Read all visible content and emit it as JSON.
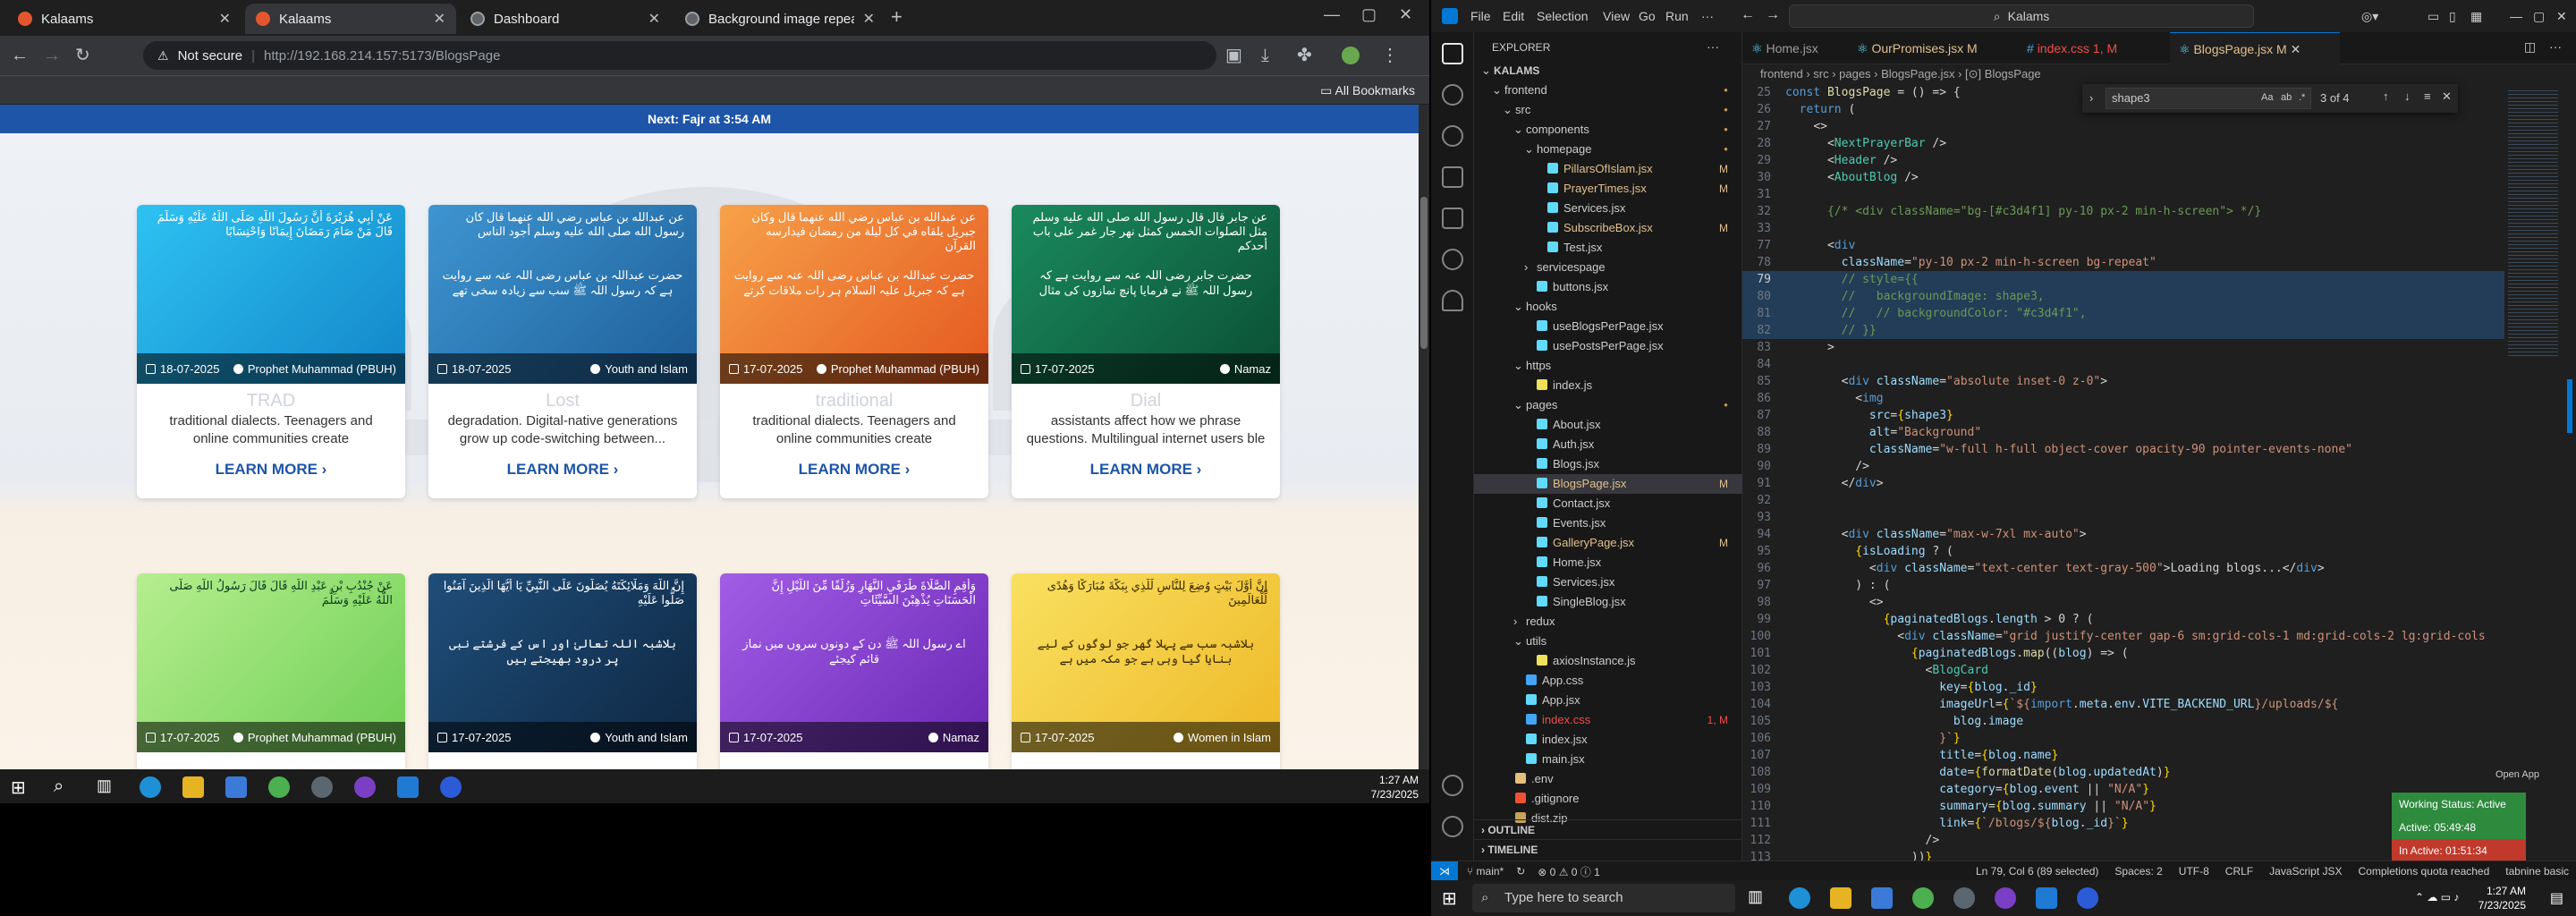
{
  "chrome": {
    "tabs": [
      {
        "label": "Kalaams",
        "active": false
      },
      {
        "label": "Kalaams",
        "active": true
      },
      {
        "label": "Dashboard",
        "active": false
      },
      {
        "label": "Background image repeat",
        "active": false
      }
    ],
    "security_label": "Not secure",
    "url": "http://192.168.214.157:5173/BlogsPage",
    "bookmarks_label": "All Bookmarks"
  },
  "site": {
    "prayer_bar": "Next: Fajr at 3:54 AM",
    "learn_more": "LEARN MORE ›",
    "cards_row1": [
      {
        "arabic": "عَنْ أَبِي هُرَيْرَةَ أَنَّ رَسُولَ اللَّهِ صَلَّى اللَّهُ عَلَيْهِ وَسَلَّمَ قَالَ مَنْ صَامَ رَمَضَانَ إِيمَانًا وَاحْتِسَابًا",
        "urdu": "",
        "date": "18-07-2025",
        "category": "Prophet Muhammad (PBUH)",
        "title": "TRAD",
        "summary": "traditional dialects. Teenagers and online communities create",
        "bg": "#1aa6e0"
      },
      {
        "arabic": "عن عبدالله بن عباس رضي الله عنهما قال كان رسول الله صلى الله عليه وسلم أجود الناس",
        "urdu": "حضرت عبداللہ بن عباس رضی اللہ عنہ سے روایت ہے کہ رسول اللہ ﷺ سب سے زیادہ سخی تھے",
        "date": "18-07-2025",
        "category": "Youth and Islam",
        "title": "Lost",
        "summary": "degradation. Digital-native generations grow up code-switching between...",
        "bg": "#2f7fbd"
      },
      {
        "arabic": "عن عبدالله بن عباس رضي الله عنهما قال وكان جبريل يلقاه في كل ليلة من رمضان فيدارسه القرآن",
        "urdu": "حضرت عبداللہ بن عباس رضی اللہ عنہ سے روایت ہے کہ جبریل علیہ السلام ہر رات ملاقات کرتے",
        "date": "17-07-2025",
        "category": "Prophet Muhammad (PBUH)",
        "title": "traditional",
        "summary": "traditional dialects. Teenagers and online communities create",
        "bg": "#f07a2a"
      },
      {
        "arabic": "عن جابر قال قال رسول الله صلى الله عليه وسلم مثل الصلوات الخمس كمثل نهر جار غمر على باب أحدكم",
        "urdu": "حضرت جابر رضی اللہ عنہ سے روایت ہے کہ رسول اللہ ﷺ نے فرمایا پانچ نمازوں کی مثال",
        "date": "17-07-2025",
        "category": "Namaz",
        "title": "Dial",
        "summary": "assistants affect how we phrase questions. Multilingual internet users ble",
        "bg": "#0f6e4a"
      }
    ],
    "cards_row2": [
      {
        "arabic": "عَنْ جُنْدُبِ بْنِ عَبْدِ اللَّهِ قَالَ قَالَ رَسُولُ اللَّهِ صَلَّى اللَّهُ عَلَيْهِ وَسَلَّمَ",
        "urdu": "",
        "date": "17-07-2025",
        "category": "Prophet Muhammad (PBUH)",
        "bg": "#9ee07a"
      },
      {
        "arabic": "إِنَّ اللَّهَ وَمَلَائِكَتَهُ يُصَلُّونَ عَلَى النَّبِيِّ يَا أَيُّهَا الَّذِينَ آمَنُوا صَلُّوا عَلَيْهِ",
        "urdu": "بلاشبہ اللہ تعالیٰ اور اس کے فرشتے نبی پر درود بھیجتے ہیں",
        "date": "17-07-2025",
        "category": "Youth and Islam",
        "bg": "#153a5e"
      },
      {
        "arabic": "وَأَقِمِ الصَّلَاةَ طَرَفَيِ النَّهَارِ وَزُلَفًا مِّنَ اللَّيْلِ إِنَّ الْحَسَنَاتِ يُذْهِبْنَ السَّيِّئَاتِ",
        "urdu": "اے رسول اللہ ﷺ دن کے دونوں سروں میں نماز قائم کیجئے",
        "date": "17-07-2025",
        "category": "Namaz",
        "bg": "#8a3fd1"
      },
      {
        "arabic": "إِنَّ أَوَّلَ بَيْتٍ وُضِعَ لِلنَّاسِ لَلَّذِي بِبَكَّةَ مُبَارَكًا وَهُدًى لِّلْعَالَمِينَ",
        "urdu": "بلاشبہ سب سے پہلا گھر جو لوگوں کے لیے بنایا گیا وہی ہے جو مکہ میں ہے",
        "date": "17-07-2025",
        "category": "Women in Islam",
        "bg": "#f6d23a"
      }
    ]
  },
  "taskbar_left": {
    "time": "1:27 AM",
    "date": "7/23/2025"
  },
  "vscode": {
    "menu": [
      "File",
      "Edit",
      "Selection",
      "View",
      "Go",
      "Run"
    ],
    "command_center": "Kalams",
    "explorer_title": "EXPLORER",
    "tabs": [
      {
        "label": "Home.jsx",
        "active": false
      },
      {
        "label": "OurPromises.jsx M",
        "active": false
      },
      {
        "label": "index.css 1, M",
        "active": false
      },
      {
        "label": "BlogsPage.jsx M",
        "active": true
      }
    ],
    "breadcrumb": "frontend › src › pages › BlogsPage.jsx › [⊙] BlogsPage",
    "find": {
      "query": "shape3",
      "count": "3 of 4"
    },
    "tree": [
      {
        "d": 0,
        "t": "KALAMS",
        "k": "root",
        "s": ""
      },
      {
        "d": 1,
        "t": "frontend",
        "k": "folder",
        "s": "dot"
      },
      {
        "d": 2,
        "t": "src",
        "k": "folder",
        "s": "dot"
      },
      {
        "d": 3,
        "t": "components",
        "k": "folder",
        "s": "dot"
      },
      {
        "d": 4,
        "t": "homepage",
        "k": "folder",
        "s": "dot"
      },
      {
        "d": 5,
        "t": "PillarsOfIslam.jsx",
        "k": "jsx",
        "s": "M"
      },
      {
        "d": 5,
        "t": "PrayerTimes.jsx",
        "k": "jsx",
        "s": "M"
      },
      {
        "d": 5,
        "t": "Services.jsx",
        "k": "jsx",
        "s": ""
      },
      {
        "d": 5,
        "t": "SubscribeBox.jsx",
        "k": "jsx",
        "s": "M"
      },
      {
        "d": 5,
        "t": "Test.jsx",
        "k": "jsx",
        "s": ""
      },
      {
        "d": 4,
        "t": "servicespage",
        "k": "folderc",
        "s": ""
      },
      {
        "d": 4,
        "t": "buttons.jsx",
        "k": "jsx",
        "s": ""
      },
      {
        "d": 3,
        "t": "hooks",
        "k": "folder",
        "s": ""
      },
      {
        "d": 4,
        "t": "useBlogsPerPage.jsx",
        "k": "jsx",
        "s": ""
      },
      {
        "d": 4,
        "t": "usePostsPerPage.jsx",
        "k": "jsx",
        "s": ""
      },
      {
        "d": 3,
        "t": "https",
        "k": "folder",
        "s": ""
      },
      {
        "d": 4,
        "t": "index.js",
        "k": "js",
        "s": ""
      },
      {
        "d": 3,
        "t": "pages",
        "k": "folder",
        "s": "dot"
      },
      {
        "d": 4,
        "t": "About.jsx",
        "k": "jsx",
        "s": ""
      },
      {
        "d": 4,
        "t": "Auth.jsx",
        "k": "jsx",
        "s": ""
      },
      {
        "d": 4,
        "t": "Blogs.jsx",
        "k": "jsx",
        "s": ""
      },
      {
        "d": 4,
        "t": "BlogsPage.jsx",
        "k": "jsx",
        "s": "M",
        "sel": true
      },
      {
        "d": 4,
        "t": "Contact.jsx",
        "k": "jsx",
        "s": ""
      },
      {
        "d": 4,
        "t": "Events.jsx",
        "k": "jsx",
        "s": ""
      },
      {
        "d": 4,
        "t": "GalleryPage.jsx",
        "k": "jsx",
        "s": "M"
      },
      {
        "d": 4,
        "t": "Home.jsx",
        "k": "jsx",
        "s": ""
      },
      {
        "d": 4,
        "t": "Services.jsx",
        "k": "jsx",
        "s": ""
      },
      {
        "d": 4,
        "t": "SingleBlog.jsx",
        "k": "jsx",
        "s": ""
      },
      {
        "d": 3,
        "t": "redux",
        "k": "folderc",
        "s": ""
      },
      {
        "d": 3,
        "t": "utils",
        "k": "folder",
        "s": ""
      },
      {
        "d": 4,
        "t": "axiosInstance.js",
        "k": "js",
        "s": ""
      },
      {
        "d": 3,
        "t": "App.css",
        "k": "css",
        "s": ""
      },
      {
        "d": 3,
        "t": "App.jsx",
        "k": "jsx",
        "s": ""
      },
      {
        "d": 3,
        "t": "index.css",
        "k": "css",
        "s": "1, M"
      },
      {
        "d": 3,
        "t": "index.jsx",
        "k": "jsx",
        "s": ""
      },
      {
        "d": 3,
        "t": "main.jsx",
        "k": "jsx",
        "s": ""
      },
      {
        "d": 2,
        "t": ".env",
        "k": "env",
        "s": ""
      },
      {
        "d": 2,
        "t": ".gitignore",
        "k": "git",
        "s": ""
      },
      {
        "d": 2,
        "t": "dist.zip",
        "k": "zip",
        "s": ""
      }
    ],
    "outline_label": "OUTLINE",
    "timeline_label": "TIMELINE",
    "code": [
      {
        "n": "25",
        "h": "<span class=\"c-kw\">const</span> <span class=\"c-fn\">BlogsPage</span> <span class=\"c-pl\">= () =&gt; {</span>"
      },
      {
        "n": "26",
        "h": "  <span class=\"c-kw\">return</span> <span class=\"c-pl\">(</span>"
      },
      {
        "n": "27",
        "h": "    <span class=\"c-pl\">&lt;&gt;</span>"
      },
      {
        "n": "28",
        "h": "      <span class=\"c-pl\">&lt;</span><span class=\"c-tag\">NextPrayerBar</span> <span class=\"c-pl\">/&gt;</span>"
      },
      {
        "n": "29",
        "h": "      <span class=\"c-pl\">&lt;</span><span class=\"c-tag\">Header</span> <span class=\"c-pl\">/&gt;</span>"
      },
      {
        "n": "30",
        "h": "      <span class=\"c-pl\">&lt;</span><span class=\"c-tag\">AboutBlog</span> <span class=\"c-pl\">/&gt;</span>"
      },
      {
        "n": "31",
        "h": ""
      },
      {
        "n": "32",
        "h": "      <span class=\"c-cm\">{/* &lt;div className=\"bg-[#c3d4f1] py-10 px-2 min-h-screen\"&gt; */}</span>"
      },
      {
        "n": "33",
        "h": ""
      },
      {
        "n": "77",
        "h": "      <span class=\"c-pl\">&lt;</span><span class=\"c-kw\">div</span>"
      },
      {
        "n": "78",
        "h": "        <span class=\"c-attr\">className</span><span class=\"c-pl\">=</span><span class=\"c-str\">\"py-10 px-2 min-h-screen bg-repeat\"</span>"
      },
      {
        "n": "79",
        "h": "        <span class=\"c-cm\">// style={{</span>",
        "sel": true
      },
      {
        "n": "80",
        "h": "        <span class=\"c-cm\">//   backgroundImage: shape3,</span>",
        "sel": true
      },
      {
        "n": "81",
        "h": "        <span class=\"c-cm\">//   // backgroundColor: \"#c3d4f1\",</span>",
        "sel": true
      },
      {
        "n": "82",
        "h": "        <span class=\"c-cm\">// }}</span>",
        "sel": true
      },
      {
        "n": "83",
        "h": "      <span class=\"c-pl\">&gt;</span>"
      },
      {
        "n": "84",
        "h": ""
      },
      {
        "n": "85",
        "h": "        <span class=\"c-pl\">&lt;</span><span class=\"c-kw\">div</span> <span class=\"c-attr\">className</span><span class=\"c-pl\">=</span><span class=\"c-str\">\"absolute inset-0 z-0\"</span><span class=\"c-pl\">&gt;</span>"
      },
      {
        "n": "86",
        "h": "          <span class=\"c-pl\">&lt;</span><span class=\"c-kw\">img</span>"
      },
      {
        "n": "87",
        "h": "            <span class=\"c-attr\">src</span><span class=\"c-pl\">=</span><span class=\"c-br\">{</span><span class=\"c-var\">shape3</span><span class=\"c-br\">}</span>"
      },
      {
        "n": "88",
        "h": "            <span class=\"c-attr\">alt</span><span class=\"c-pl\">=</span><span class=\"c-str\">\"Background\"</span>"
      },
      {
        "n": "89",
        "h": "            <span class=\"c-attr\">className</span><span class=\"c-pl\">=</span><span class=\"c-str\">\"w-full h-full object-cover opacity-90 pointer-events-none\"</span>"
      },
      {
        "n": "90",
        "h": "          <span class=\"c-pl\">/&gt;</span>"
      },
      {
        "n": "91",
        "h": "        <span class=\"c-pl\">&lt;/</span><span class=\"c-kw\">div</span><span class=\"c-pl\">&gt;</span>"
      },
      {
        "n": "92",
        "h": ""
      },
      {
        "n": "93",
        "h": ""
      },
      {
        "n": "94",
        "h": "        <span class=\"c-pl\">&lt;</span><span class=\"c-kw\">div</span> <span class=\"c-attr\">className</span><span class=\"c-pl\">=</span><span class=\"c-str\">\"max-w-7xl mx-auto\"</span><span class=\"c-pl\">&gt;</span>"
      },
      {
        "n": "95",
        "h": "          <span class=\"c-br\">{</span><span class=\"c-var\">isLoading</span> <span class=\"c-pl\">? (</span>"
      },
      {
        "n": "96",
        "h": "            <span class=\"c-pl\">&lt;</span><span class=\"c-kw\">div</span> <span class=\"c-attr\">className</span><span class=\"c-pl\">=</span><span class=\"c-str\">\"text-center text-gray-500\"</span><span class=\"c-pl\">&gt;Loading blogs...&lt;/</span><span class=\"c-kw\">div</span><span class=\"c-pl\">&gt;</span>"
      },
      {
        "n": "97",
        "h": "          <span class=\"c-pl\">) : (</span>"
      },
      {
        "n": "98",
        "h": "            <span class=\"c-pl\">&lt;&gt;</span>"
      },
      {
        "n": "99",
        "h": "              <span class=\"c-br\">{</span><span class=\"c-var\">paginatedBlogs</span><span class=\"c-pl\">.</span><span class=\"c-var\">length</span> <span class=\"c-pl\">&gt; 0 ? (</span>"
      },
      {
        "n": "100",
        "h": "                <span class=\"c-pl\">&lt;</span><span class=\"c-kw\">div</span> <span class=\"c-attr\">className</span><span class=\"c-pl\">=</span><span class=\"c-str\">\"grid justify-center gap-6 sm:grid-cols-1 md:grid-cols-2 lg:grid-cols</span>"
      },
      {
        "n": "101",
        "h": "                  <span class=\"c-br\">{</span><span class=\"c-var\">paginatedBlogs</span><span class=\"c-pl\">.</span><span class=\"c-fn\">map</span><span class=\"c-pl\">((</span><span class=\"c-var\">blog</span><span class=\"c-pl\">) =&gt; (</span>"
      },
      {
        "n": "102",
        "h": "                    <span class=\"c-pl\">&lt;</span><span class=\"c-tag\">BlogCard</span>"
      },
      {
        "n": "103",
        "h": "                      <span class=\"c-attr\">key</span><span class=\"c-pl\">=</span><span class=\"c-br\">{</span><span class=\"c-var\">blog</span><span class=\"c-pl\">.</span><span class=\"c-var\">_id</span><span class=\"c-br\">}</span>"
      },
      {
        "n": "104",
        "h": "                      <span class=\"c-attr\">imageUrl</span><span class=\"c-pl\">=</span><span class=\"c-br\">{</span><span class=\"c-str\">`${</span><span class=\"c-kw\">import</span><span class=\"c-pl\">.</span><span class=\"c-var\">meta</span><span class=\"c-pl\">.</span><span class=\"c-var\">env</span><span class=\"c-pl\">.</span><span class=\"c-var\">VITE_BACKEND_URL</span><span class=\"c-str\">}/uploads/${</span>"
      },
      {
        "n": "105",
        "h": "                        <span class=\"c-var\">blog</span><span class=\"c-pl\">.</span><span class=\"c-var\">image</span>"
      },
      {
        "n": "106",
        "h": "                      <span class=\"c-str\">}`</span><span class=\"c-br\">}</span>"
      },
      {
        "n": "107",
        "h": "                      <span class=\"c-attr\">title</span><span class=\"c-pl\">=</span><span class=\"c-br\">{</span><span class=\"c-var\">blog</span><span class=\"c-pl\">.</span><span class=\"c-var\">name</span><span class=\"c-br\">}</span>"
      },
      {
        "n": "108",
        "h": "                      <span class=\"c-attr\">date</span><span class=\"c-pl\">=</span><span class=\"c-br\">{</span><span class=\"c-fn\">formatDate</span><span class=\"c-pl\">(</span><span class=\"c-var\">blog</span><span class=\"c-pl\">.</span><span class=\"c-var\">updatedAt</span><span class=\"c-pl\">)</span><span class=\"c-br\">}</span>"
      },
      {
        "n": "109",
        "h": "                      <span class=\"c-attr\">category</span><span class=\"c-pl\">=</span><span class=\"c-br\">{</span><span class=\"c-var\">blog</span><span class=\"c-pl\">.</span><span class=\"c-var\">event</span> <span class=\"c-pl\">||</span> <span class=\"c-str\">\"N/A\"</span><span class=\"c-br\">}</span>"
      },
      {
        "n": "110",
        "h": "                      <span class=\"c-attr\">summary</span><span class=\"c-pl\">=</span><span class=\"c-br\">{</span><span class=\"c-var\">blog</span><span class=\"c-pl\">.</span><span class=\"c-var\">summary</span> <span class=\"c-pl\">||</span> <span class=\"c-str\">\"N/A\"</span><span class=\"c-br\">}</span>"
      },
      {
        "n": "111",
        "h": "                      <span class=\"c-attr\">link</span><span class=\"c-pl\">=</span><span class=\"c-br\">{</span><span class=\"c-str\">`/blogs/${</span><span class=\"c-var\">blog</span><span class=\"c-pl\">.</span><span class=\"c-var\">_id</span><span class=\"c-str\">}`</span><span class=\"c-br\">}</span>"
      },
      {
        "n": "112",
        "h": "                    <span class=\"c-pl\">/&gt;</span>"
      },
      {
        "n": "113",
        "h": "                  <span class=\"c-pl\">))</span><span class=\"c-br\">}</span>"
      }
    ],
    "status": {
      "branch": "main*",
      "errors": "⊗ 0 ⚠ 0 ⓘ 1",
      "position": "Ln 79, Col 6 (89 selected)",
      "spaces": "Spaces: 2",
      "encoding": "UTF-8",
      "eol": "CRLF",
      "language": "JavaScript JSX",
      "quota": "Completions quota reached",
      "tabnine": "tabnine basic"
    },
    "badges": {
      "open_app": "Open App",
      "working": "Working Status: Active",
      "active": "Active: 05:49:48",
      "inactive": "In Active: 01:51:34"
    }
  },
  "taskbar_right": {
    "search_placeholder": "Type here to search",
    "time": "1:27 AM",
    "date": "7/23/2025"
  }
}
